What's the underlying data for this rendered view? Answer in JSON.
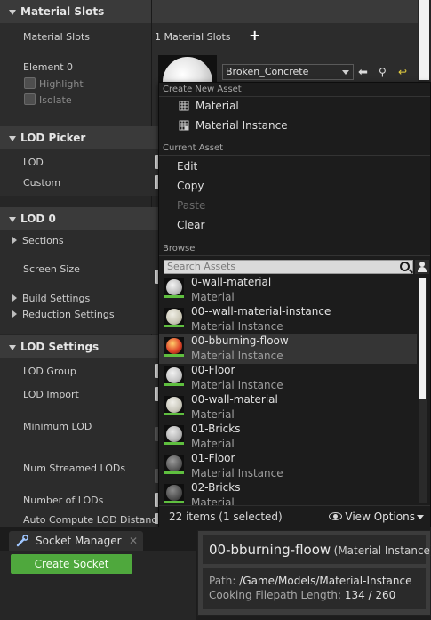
{
  "details": {
    "material_slots": {
      "header": "Material Slots",
      "row_label": "Material Slots",
      "count_text": "1 Material Slots",
      "add_icon": "plus-icon",
      "element_label": "Element 0",
      "highlight_label": "Highlight",
      "isolate_label": "Isolate",
      "material_name": "Broken_Concrete"
    },
    "lod_picker": {
      "header": "LOD Picker",
      "lod_label": "LOD",
      "custom_label": "Custom"
    },
    "lod0": {
      "header": "LOD 0",
      "sections_label": "Sections",
      "screen_size_label": "Screen Size",
      "build_settings_label": "Build Settings",
      "reduction_settings_label": "Reduction Settings"
    },
    "lod_settings": {
      "header": "LOD Settings",
      "lod_group_label": "LOD Group",
      "lod_import_label": "LOD Import",
      "minimum_lod_label": "Minimum LOD",
      "num_streamed_lods_label": "Num Streamed LODs",
      "number_of_lods_label": "Number of LODs",
      "auto_compute_label": "Auto Compute LOD Distance"
    }
  },
  "menu": {
    "create_heading": "Create New Asset",
    "create_items": [
      {
        "label": "Material",
        "icon": "material-icon"
      },
      {
        "label": "Material Instance",
        "icon": "material-instance-icon"
      }
    ],
    "current_heading": "Current Asset",
    "current_items": [
      {
        "label": "Edit",
        "enabled": true
      },
      {
        "label": "Copy",
        "enabled": true
      },
      {
        "label": "Paste",
        "enabled": false
      },
      {
        "label": "Clear",
        "enabled": true
      }
    ],
    "browse_heading": "Browse",
    "search_placeholder": "Search Assets",
    "assets": [
      {
        "name": "0-wall-material",
        "type": "Material",
        "selected": false
      },
      {
        "name": "00--wall-material-instance",
        "type": "Material Instance",
        "selected": false
      },
      {
        "name": "00-bburning-floow",
        "type": "Material Instance",
        "selected": true
      },
      {
        "name": "00-Floor",
        "type": "Material Instance",
        "selected": false
      },
      {
        "name": "00-wall-material",
        "type": "Material",
        "selected": false
      },
      {
        "name": "01-Bricks",
        "type": "Material",
        "selected": false
      },
      {
        "name": "01-Floor",
        "type": "Material Instance",
        "selected": false
      },
      {
        "name": "02-Bricks",
        "type": "Material",
        "selected": false
      }
    ],
    "footer_count": "22 items (1 selected)",
    "view_options": "View Options"
  },
  "socket_manager": {
    "tab_label": "Socket Manager",
    "close_glyph": "✕",
    "create_button": "Create Socket"
  },
  "tooltip": {
    "asset_name": "00-bburning-floow",
    "asset_type": "(Material Instance)",
    "path_label": "Path:",
    "path_value": "/Game/Models/Material-Instance",
    "cooking_label": "Cooking Filepath Length:",
    "cooking_value": "134 / 260"
  },
  "colors": {
    "accent_green": "#4fa83d",
    "selection_bg": "#353535",
    "asset_tag_green": "#5fbf3f"
  }
}
